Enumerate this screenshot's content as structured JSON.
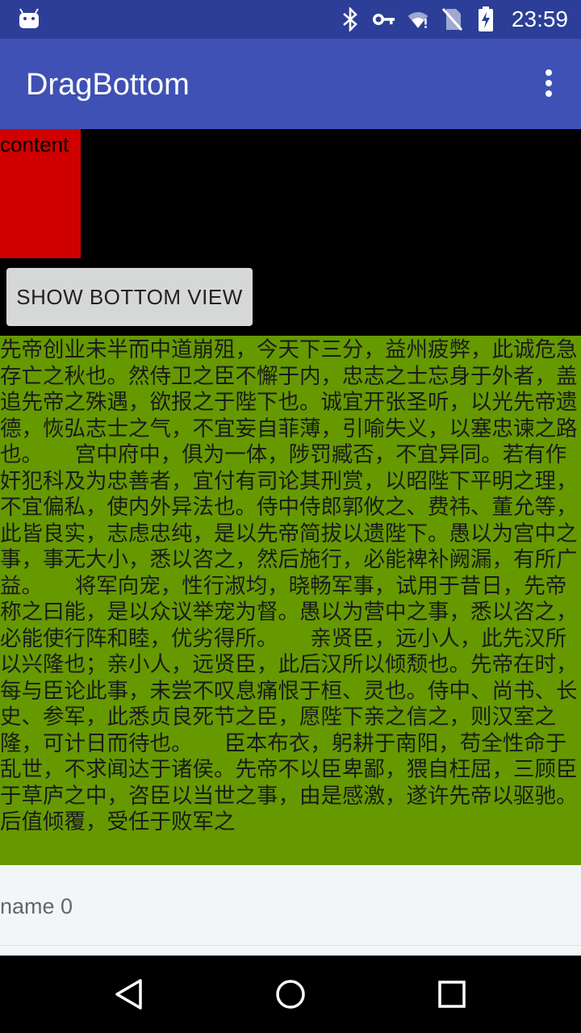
{
  "status_bar": {
    "time": "23:59",
    "icons": [
      "android-icon",
      "bluetooth-icon",
      "key-icon",
      "wifi-icon",
      "no-sim-icon",
      "battery-charging-icon"
    ]
  },
  "app_bar": {
    "title": "DragBottom",
    "menu_icon": "overflow-menu-icon"
  },
  "content_block": {
    "label": "content",
    "color": "#d00000"
  },
  "show_button": {
    "label": "SHOW BOTTOM VIEW"
  },
  "article": {
    "background": "#669900",
    "text": "先帝创业未半而中道崩殂，今天下三分，益州疲弊，此诚危急存亡之秋也。然侍卫之臣不懈于内，忠志之士忘身于外者，盖追先帝之殊遇，欲报之于陛下也。诚宜开张圣听，以光先帝遗德，恢弘志士之气，不宜妄自菲薄，引喻失义，以塞忠谏之路也。　　宫中府中，俱为一体，陟罚臧否，不宜异同。若有作奸犯科及为忠善者，宜付有司论其刑赏，以昭陛下平明之理，不宜偏私，使内外异法也。侍中侍郎郭攸之、费祎、董允等，此皆良实，志虑忠纯，是以先帝简拔以遗陛下。愚以为宫中之事，事无大小，悉以咨之，然后施行，必能裨补阙漏，有所广益。　　将军向宠，性行淑均，晓畅军事，试用于昔日，先帝称之曰能，是以众议举宠为督。愚以为营中之事，悉以咨之，必能使行阵和睦，优劣得所。　　亲贤臣，远小人，此先汉所以兴隆也；亲小人，远贤臣，此后汉所以倾颓也。先帝在时，每与臣论此事，未尝不叹息痛恨于桓、灵也。侍中、尚书、长史、参军，此悉贞良死节之臣，愿陛下亲之信之，则汉室之隆，可计日而待也。　　臣本布衣，躬耕于南阳，苟全性命于乱世，不求闻达于诸侯。先帝不以臣卑鄙，猥自枉屈，三顾臣于草庐之中，咨臣以当世之事，由是感激，遂许先帝以驱驰。后值倾覆，受任于败军之"
  },
  "bottom_sheet": {
    "items": [
      {
        "name": "name 0"
      }
    ]
  },
  "nav_bar": {
    "buttons": [
      "back-icon",
      "home-icon",
      "recents-icon"
    ]
  }
}
